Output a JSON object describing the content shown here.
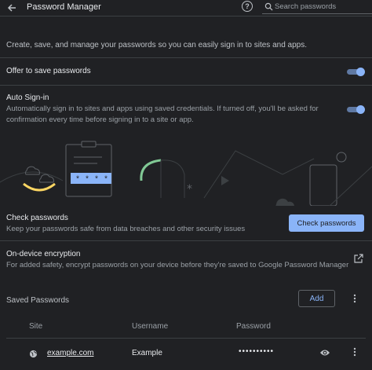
{
  "header": {
    "title": "Password Manager",
    "search_placeholder": "Search passwords",
    "help_glyph": "?"
  },
  "intro": "Create, save, and manage your passwords so you can easily sign in to sites and apps.",
  "offer_to_save": {
    "label": "Offer to save passwords",
    "enabled": true
  },
  "auto_signin": {
    "label": "Auto Sign-in",
    "description_line1": "Automatically sign in to sites and apps using saved credentials. If turned off, you'll be asked for",
    "description_line2": "confirmation every time before signing in to a site or app.",
    "enabled": true
  },
  "check_passwords": {
    "title": "Check passwords",
    "description": "Keep your passwords safe from data breaches and other security issues",
    "button_label": "Check passwords"
  },
  "encryption": {
    "title": "On-device encryption",
    "description": "For added safety, encrypt passwords on your device before they're saved to Google Password Manager"
  },
  "saved_passwords": {
    "title": "Saved Passwords",
    "add_label": "Add",
    "columns": [
      "Site",
      "Username",
      "Password"
    ],
    "rows": [
      {
        "site": "example.com",
        "username": "Example",
        "password": "••••••••••"
      }
    ]
  },
  "banner": {
    "masked_text": "* * * * |"
  },
  "colors": {
    "background": "#202124",
    "accent": "#8ab4f8",
    "divider": "#3c4043",
    "banner_yellow": "#fdd663",
    "banner_green": "#81c995"
  },
  "icons": [
    "back-arrow-icon",
    "help-icon",
    "search-icon",
    "external-link-icon",
    "more-vert-icon",
    "globe-icon",
    "eye-icon"
  ]
}
